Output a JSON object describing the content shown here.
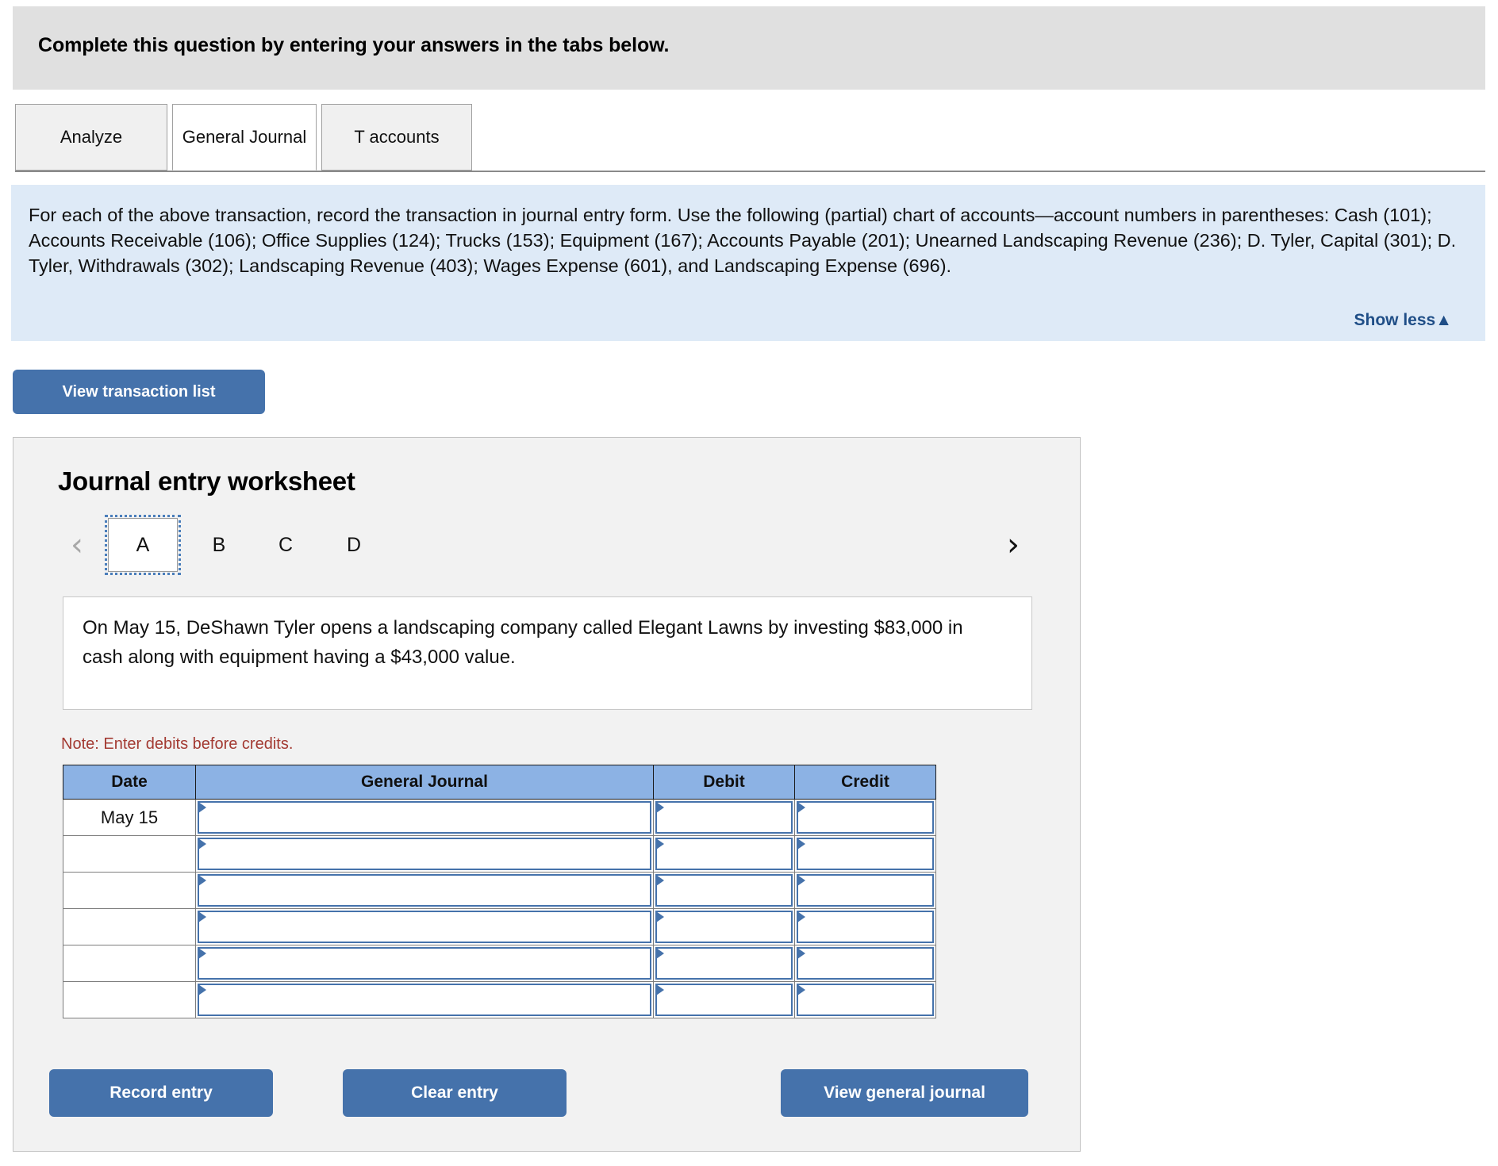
{
  "banner": {
    "title": "Complete this question by entering your answers in the tabs below."
  },
  "tabs": [
    {
      "id": "analyze",
      "label": "Analyze",
      "active": false
    },
    {
      "id": "general-journal",
      "label": "General Journal",
      "active": true
    },
    {
      "id": "t-accounts",
      "label": "T accounts",
      "active": false
    }
  ],
  "instructions": {
    "text": "For each of the above transaction, record the transaction in journal entry form. Use the following (partial) chart of accounts—account numbers in parentheses: Cash (101); Accounts Receivable (106); Office Supplies (124); Trucks (153); Equipment (167); Accounts Payable (201); Unearned Landscaping Revenue (236); D. Tyler, Capital (301); D. Tyler, Withdrawals (302); Landscaping Revenue (403); Wages Expense (601), and Landscaping Expense (696).",
    "show_less_label": "Show less▲"
  },
  "view_transaction_list_button": "View transaction list",
  "worksheet": {
    "title": "Journal entry worksheet",
    "pager": {
      "prev_icon": "‹",
      "next_icon": "›",
      "prev_enabled": false,
      "next_enabled": true,
      "pages": [
        "A",
        "B",
        "C",
        "D"
      ],
      "current_page": "A"
    },
    "transaction_text": "On May 15, DeShawn Tyler opens a landscaping company called Elegant Lawns by investing $83,000 in cash along with equipment having a $43,000 value.",
    "note": "Note: Enter debits before credits.",
    "table": {
      "headers": [
        "Date",
        "General Journal",
        "Debit",
        "Credit"
      ],
      "rows": [
        {
          "date": "May 15",
          "general_journal": "",
          "debit": "",
          "credit": ""
        },
        {
          "date": "",
          "general_journal": "",
          "debit": "",
          "credit": ""
        },
        {
          "date": "",
          "general_journal": "",
          "debit": "",
          "credit": ""
        },
        {
          "date": "",
          "general_journal": "",
          "debit": "",
          "credit": ""
        },
        {
          "date": "",
          "general_journal": "",
          "debit": "",
          "credit": ""
        },
        {
          "date": "",
          "general_journal": "",
          "debit": "",
          "credit": ""
        }
      ]
    },
    "buttons": {
      "record": "Record entry",
      "clear": "Clear entry",
      "view_general_journal": "View general journal"
    }
  },
  "colors": {
    "banner_bg": "#e0e0e0",
    "info_bg": "#deeaf7",
    "accent_blue": "#4572ab",
    "link_blue": "#1f4e87",
    "table_header_blue": "#8cb2e4",
    "note_red": "#a33a32",
    "panel_bg": "#f2f2f2"
  }
}
